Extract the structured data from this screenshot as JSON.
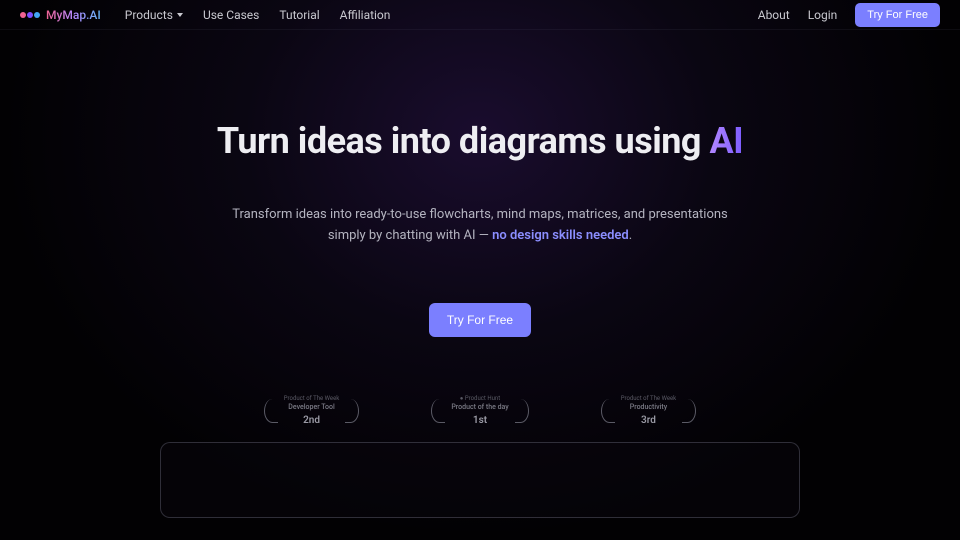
{
  "brand": {
    "name": "MyMap.AI"
  },
  "nav": {
    "products": "Products",
    "use_cases": "Use Cases",
    "tutorial": "Tutorial",
    "affiliation": "Affiliation"
  },
  "header_right": {
    "about": "About",
    "login": "Login",
    "cta": "Try For Free"
  },
  "hero": {
    "title_prefix": "Turn ideas into diagrams using ",
    "title_ai": "AI",
    "subtitle_a": "Transform ideas into ready-to-use flowcharts, mind maps, matrices, and presentations simply by chatting with AI — ",
    "subtitle_emphasis": "no design skills needed",
    "subtitle_b": ".",
    "cta": "Try For Free"
  },
  "awards": [
    {
      "line1": "Product of The Week",
      "line2": "Developer Tool",
      "rank": "2nd"
    },
    {
      "line1": "● Product Hunt",
      "line2": "Product of the day",
      "rank": "1st"
    },
    {
      "line1": "Product of The Week",
      "line2": "Productivity",
      "rank": "3rd"
    }
  ]
}
